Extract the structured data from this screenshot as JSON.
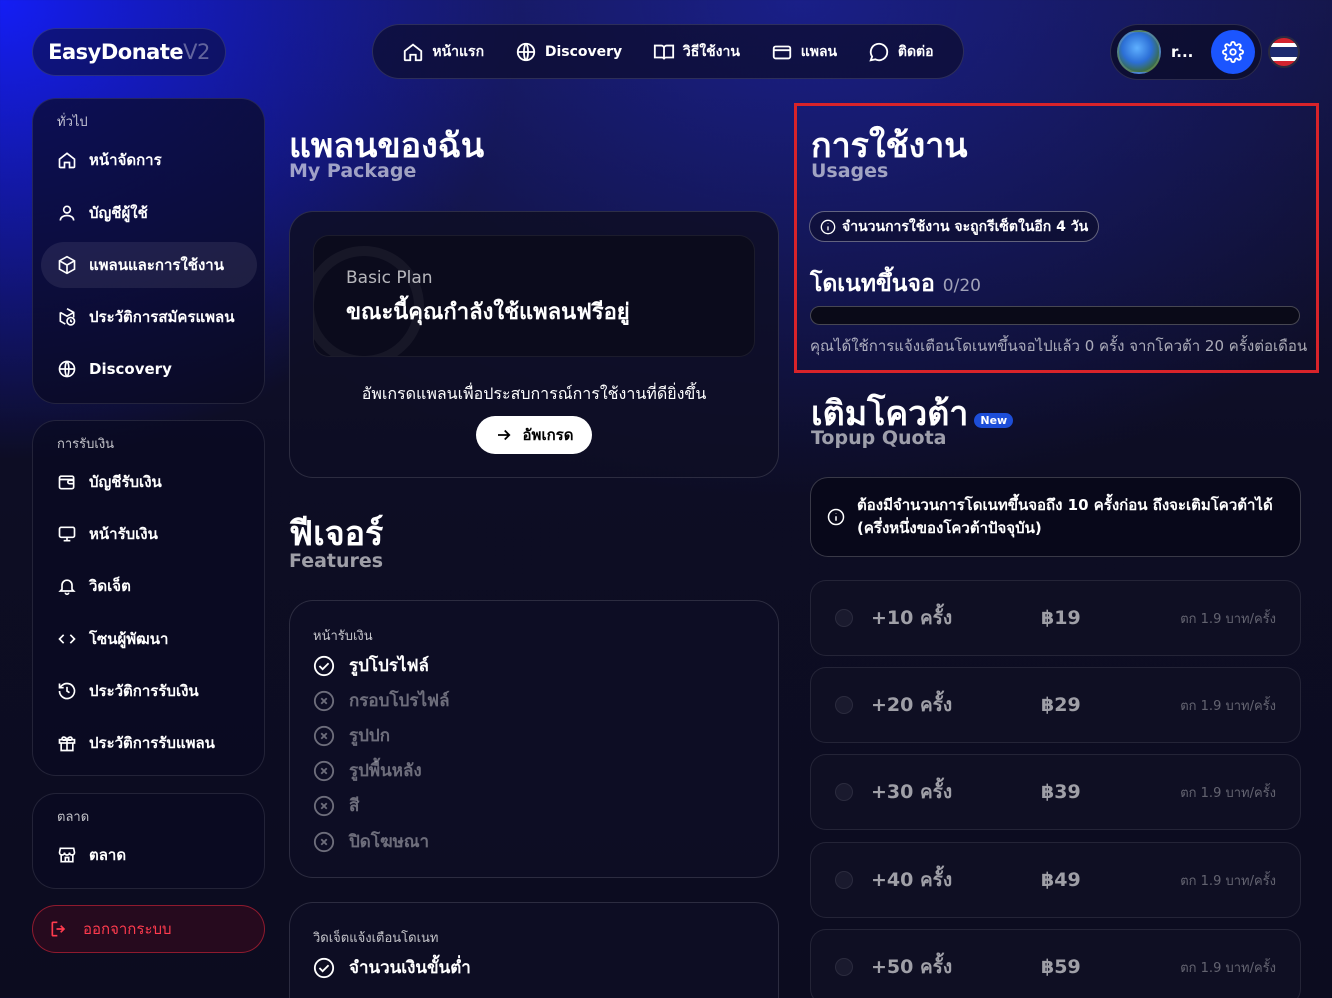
{
  "brand": {
    "name": "EasyDonate",
    "version": "V2"
  },
  "topnav": {
    "items": [
      {
        "label": "หน้าแรก",
        "icon": "home-icon"
      },
      {
        "label": "Discovery",
        "icon": "globe-icon"
      },
      {
        "label": "วิธีใช้งาน",
        "icon": "book-icon"
      },
      {
        "label": "แพลน",
        "icon": "card-icon"
      },
      {
        "label": "ติดต่อ",
        "icon": "chat-icon"
      }
    ]
  },
  "user": {
    "name": "r...",
    "settings_icon": "gear-icon",
    "language_flag": "thai-flag-icon"
  },
  "sidebar": {
    "general": {
      "heading": "ทั่วไป",
      "items": [
        {
          "label": "หน้าจัดการ",
          "icon": "home-icon"
        },
        {
          "label": "บัญชีผู้ใช้",
          "icon": "user-icon"
        },
        {
          "label": "แพลนและการใช้งาน",
          "icon": "box-icon",
          "active": true
        },
        {
          "label": "ประวัติการสมัครแพลน",
          "icon": "history-box-icon"
        },
        {
          "label": "Discovery",
          "icon": "globe-icon"
        }
      ]
    },
    "payment": {
      "heading": "การรับเงิน",
      "items": [
        {
          "label": "บัญชีรับเงิน",
          "icon": "wallet-icon"
        },
        {
          "label": "หน้ารับเงิน",
          "icon": "monitor-icon"
        },
        {
          "label": "วิดเจ็ต",
          "icon": "bell-icon"
        },
        {
          "label": "โซนผู้พัฒนา",
          "icon": "code-icon"
        },
        {
          "label": "ประวัติการรับเงิน",
          "icon": "history-icon"
        },
        {
          "label": "ประวัติการรับแพลน",
          "icon": "gift-icon"
        }
      ]
    },
    "market": {
      "heading": "ตลาด",
      "items": [
        {
          "label": "ตลาด",
          "icon": "store-icon"
        }
      ]
    },
    "logout_label": "ออกจากระบบ"
  },
  "package": {
    "title": "แพลนของฉัน",
    "subtitle": "My Package",
    "plan_name": "Basic Plan",
    "plan_status": "ขณะนี้คุณกำลังใช้แพลนฟรีอยู่",
    "upgrade_text": "อัพเกรดแพลนเพื่อประสบการณ์การใช้งานที่ดียิ่งขึ้น",
    "upgrade_button": "อัพเกรด"
  },
  "features": {
    "title": "ฟีเจอร์",
    "subtitle": "Features",
    "groups": [
      {
        "heading": "หน้ารับเงิน",
        "items": [
          {
            "label": "รูปโปรไฟล์",
            "enabled": true
          },
          {
            "label": "กรอบโปรไฟล์",
            "enabled": false
          },
          {
            "label": "รูปปก",
            "enabled": false
          },
          {
            "label": "รูปพื้นหลัง",
            "enabled": false
          },
          {
            "label": "สี",
            "enabled": false
          },
          {
            "label": "ปิดโฆษณา",
            "enabled": false
          }
        ]
      },
      {
        "heading": "วิดเจ็ตแจ้งเตือนโดเนท",
        "items": [
          {
            "label": "จำนวนเงินขั้นต่ำ",
            "enabled": true
          }
        ]
      }
    ]
  },
  "usage": {
    "title": "การใช้งาน",
    "subtitle": "Usages",
    "reset_notice": "จำนวนการใช้งาน จะถูกรีเซ็ตในอีก 4 วัน",
    "metric_label": "โดเนทขึ้นจอ",
    "metric_value": "0/20",
    "progress_fraction": 0,
    "description": "คุณได้ใช้การแจ้งเตือนโดเนทขึ้นจอไปแล้ว 0 ครั้ง จากโควต้า 20 ครั้งต่อเดือน"
  },
  "topup": {
    "title": "เติมโควต้า",
    "badge": "New",
    "subtitle": "Topup Quota",
    "notice_line1": "ต้องมีจำนวนการโดเนทขึ้นจอถึง 10 ครั้งก่อน ถึงจะเติมโควต้าได้",
    "notice_line2": "(ครึ่งหนึ่งของโควต้าปัจจุบัน)",
    "options": [
      {
        "amount": "+10 ครั้ง",
        "price": "฿19",
        "unit": "ตก 1.9 บาท/ครั้ง"
      },
      {
        "amount": "+20 ครั้ง",
        "price": "฿29",
        "unit": "ตก 1.9 บาท/ครั้ง"
      },
      {
        "amount": "+30 ครั้ง",
        "price": "฿39",
        "unit": "ตก 1.9 บาท/ครั้ง"
      },
      {
        "amount": "+40 ครั้ง",
        "price": "฿49",
        "unit": "ตก 1.9 บาท/ครั้ง"
      },
      {
        "amount": "+50 ครั้ง",
        "price": "฿59",
        "unit": "ตก 1.9 บาท/ครั้ง"
      }
    ]
  },
  "colors": {
    "accent": "#1b55ff",
    "danger": "#ff3b4e",
    "highlight_border": "#d8232a",
    "badge": "#1d4ed8"
  }
}
